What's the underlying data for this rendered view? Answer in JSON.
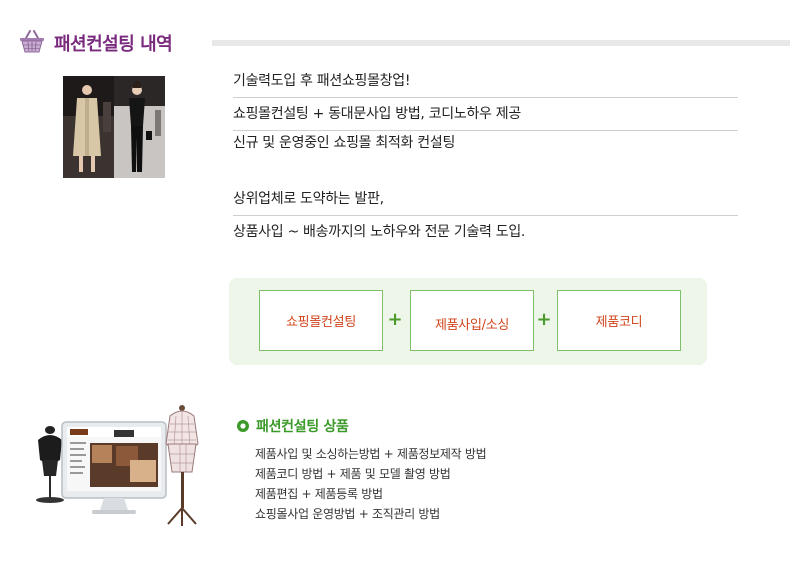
{
  "header": {
    "title": "패션컨설팅 내역",
    "icon": "basket-icon",
    "title_color": "#7a2b7e"
  },
  "photo": {
    "icon": "fashion-runway-photo"
  },
  "description": {
    "lines": [
      "기술력도입 후 패션쇼핑몰창업!",
      "쇼핑몰컨설팅 + 동대문사입 방법, 코디노하우 제공",
      "신규 및 운영중인 쇼핑몰 최적화 컨설팅",
      "상위업체로 도약하는 발판,",
      "상품사입 ~ 배송까지의 노하우와 전문 기술력 도입."
    ]
  },
  "services": {
    "items": [
      "쇼핑몰컨설팅",
      "제품사입/소싱",
      "제품코디"
    ],
    "plus": "+",
    "panel_color": "#eef6ea",
    "border_color": "#7fc06c",
    "text_color": "#d2451c"
  },
  "product": {
    "heading": "패션컨설팅 상품",
    "heading_color": "#3b9a2a",
    "items": [
      "제품사입 및 소싱하는방법 + 제품정보제작 방법",
      "제품코디 방법 + 제품 및 모델 촬영 방법",
      "제품편집 + 제품등록 방법",
      "쇼핑몰사업 운영방법 + 조직관리 방법"
    ],
    "illustration_icon": "mannequin-monitor-illustration"
  }
}
